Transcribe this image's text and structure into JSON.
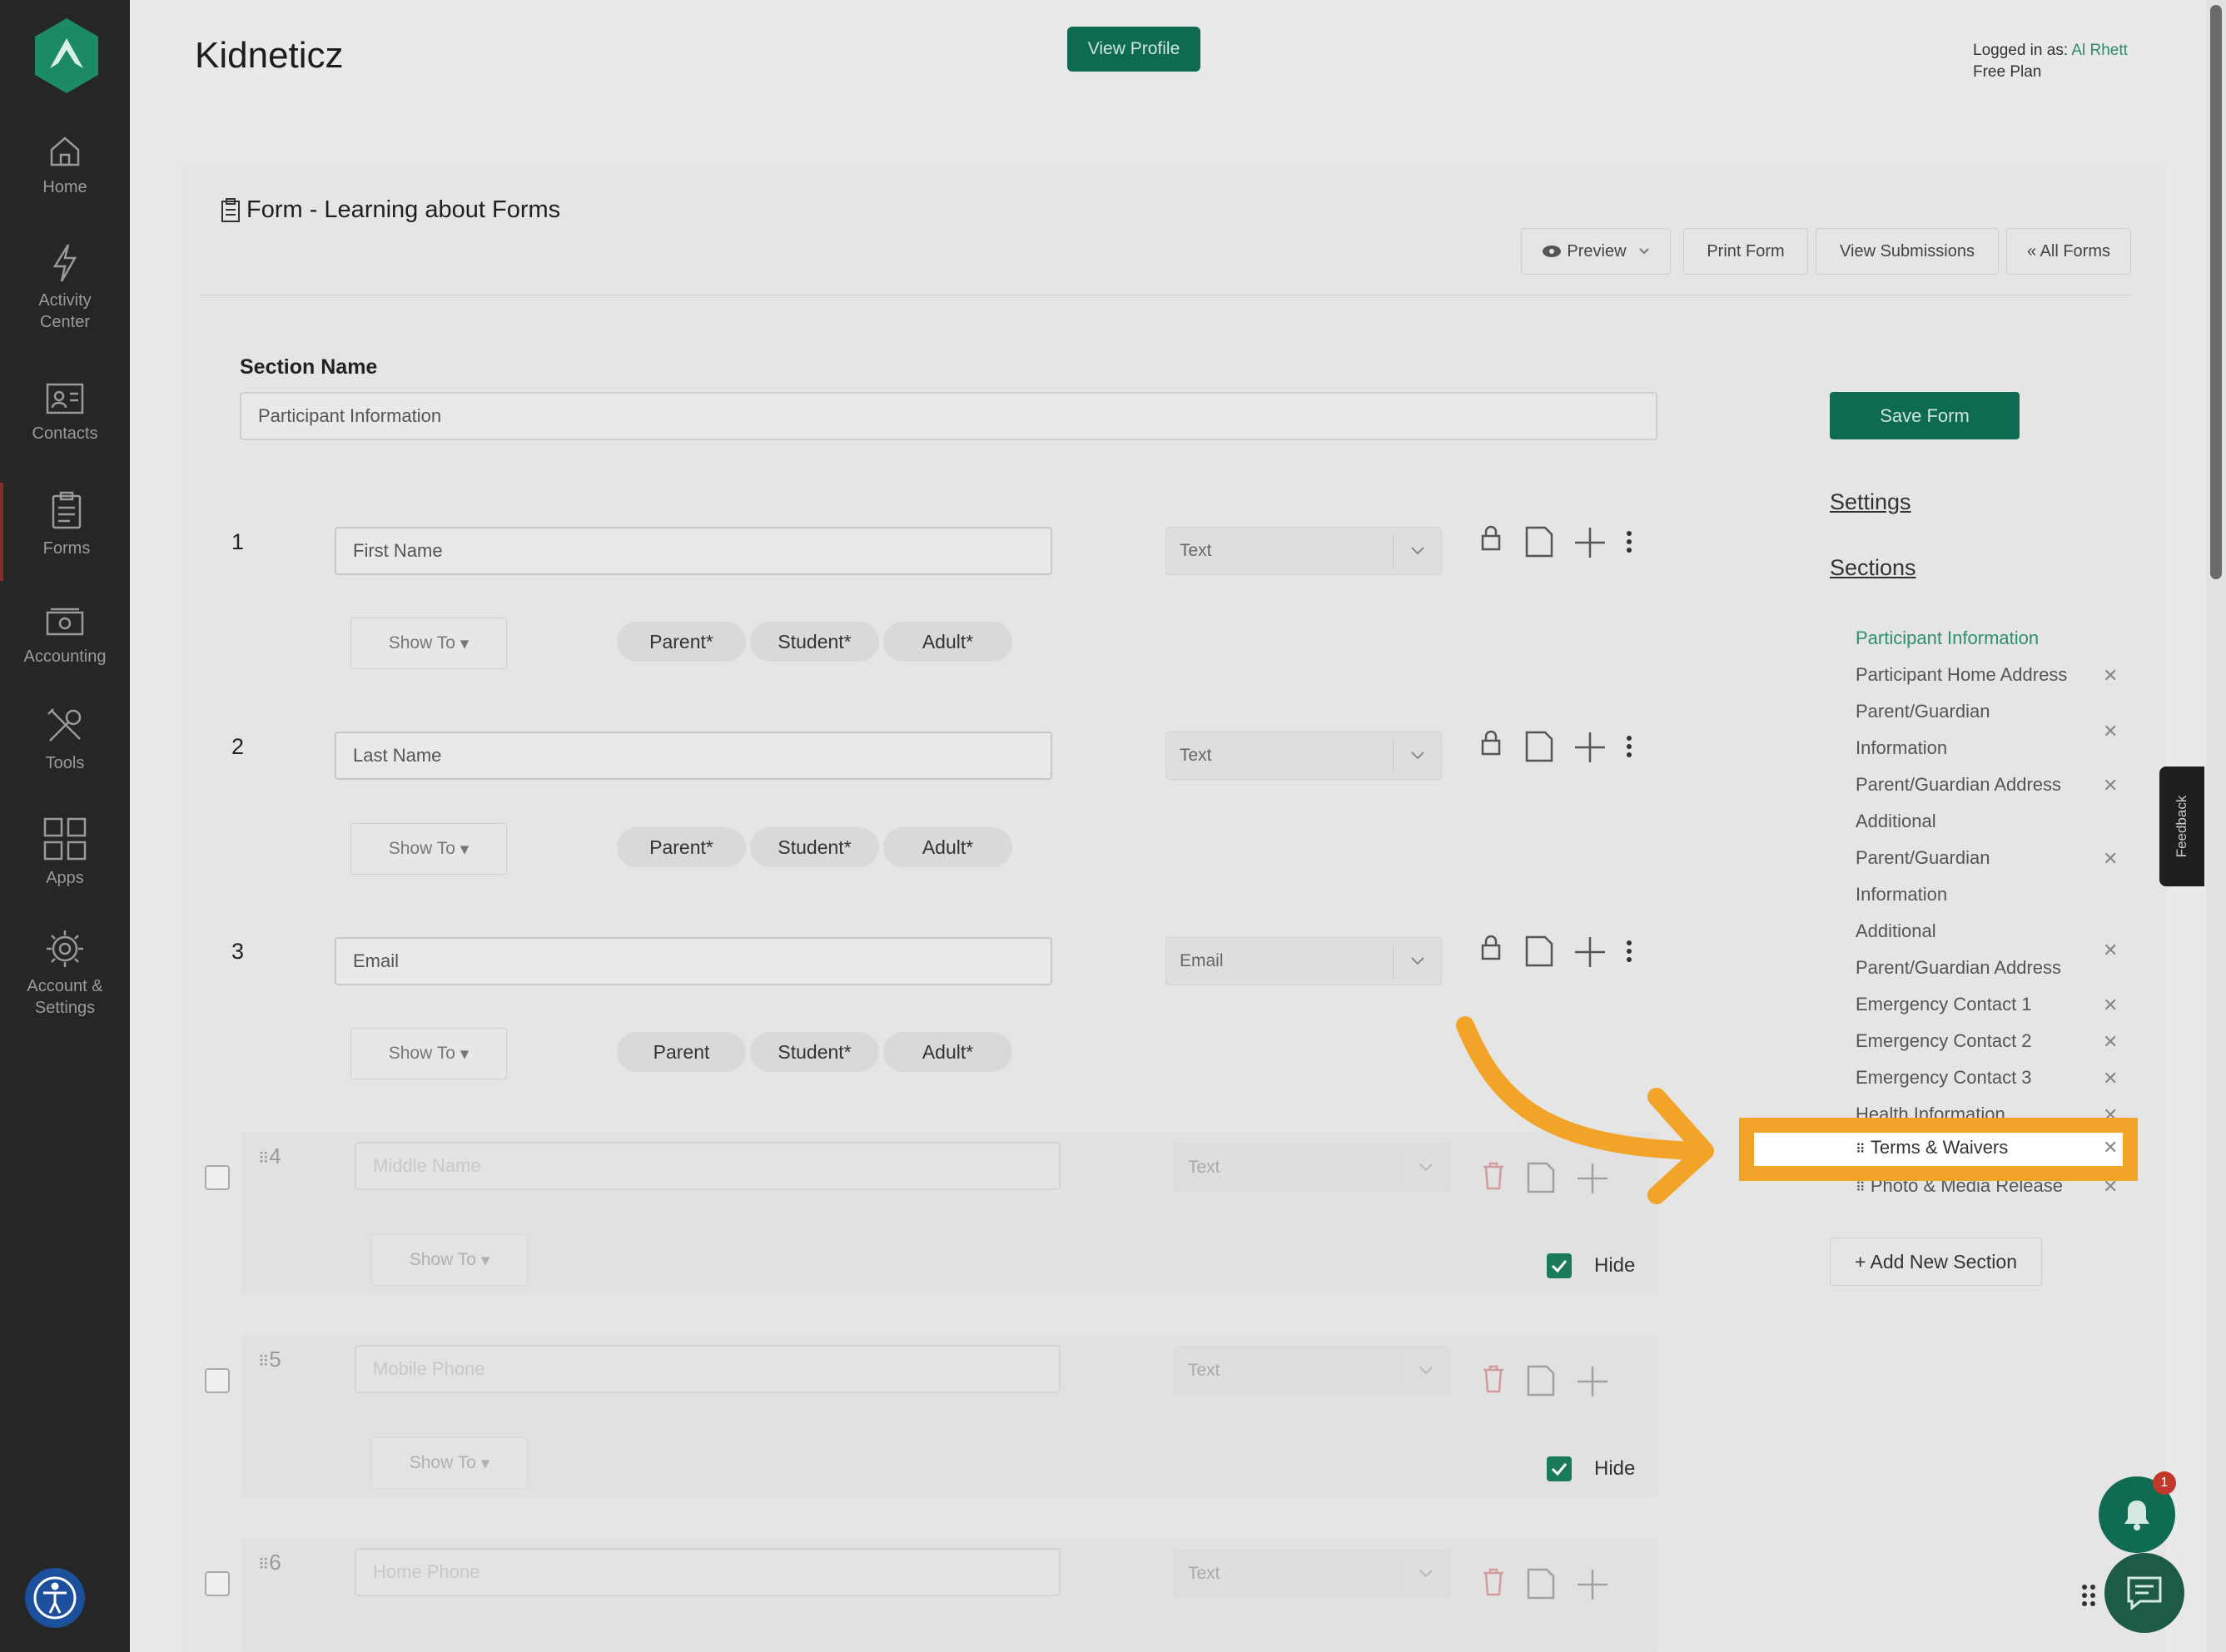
{
  "app": {
    "title": "Kidneticz",
    "view_profile": "View Profile"
  },
  "account": {
    "logged_in_prefix": "Logged in as:",
    "user": "Al Rhett",
    "plan": "Free Plan"
  },
  "sidebar": {
    "items": [
      {
        "label": "Home",
        "icon": "home-icon"
      },
      {
        "label": "Activity Center",
        "icon": "lightning-icon"
      },
      {
        "label": "Contacts",
        "icon": "contacts-icon"
      },
      {
        "label": "Forms",
        "icon": "clipboard-icon",
        "active": true
      },
      {
        "label": "Accounting",
        "icon": "money-icon"
      },
      {
        "label": "Tools",
        "icon": "tools-icon"
      },
      {
        "label": "Apps",
        "icon": "apps-grid-icon"
      },
      {
        "label": "Account & Settings",
        "icon": "gear-icon"
      }
    ]
  },
  "form": {
    "title": "Form - Learning about Forms",
    "toolbar": {
      "preview": "Preview",
      "print": "Print Form",
      "submissions": "View Submissions",
      "all_forms": "« All Forms"
    },
    "section_label": "Section Name",
    "section_value": "Participant Information",
    "save": "Save Form",
    "fields": [
      {
        "num": "1",
        "value": "First Name",
        "type": "Text",
        "show_to": "Show To",
        "pills": [
          "Parent*",
          "Student*",
          "Adult*"
        ]
      },
      {
        "num": "2",
        "value": "Last Name",
        "type": "Text",
        "show_to": "Show To",
        "pills": [
          "Parent*",
          "Student*",
          "Adult*"
        ]
      },
      {
        "num": "3",
        "value": "Email",
        "type": "Email",
        "show_to": "Show To",
        "pills": [
          "Parent",
          "Student*",
          "Adult*"
        ]
      }
    ],
    "hidden_fields": [
      {
        "num": "4",
        "placeholder": "Middle Name",
        "type": "Text",
        "show_to": "Show To",
        "hide": "Hide"
      },
      {
        "num": "5",
        "placeholder": "Mobile Phone",
        "type": "Text",
        "show_to": "Show To",
        "hide": "Hide"
      },
      {
        "num": "6",
        "placeholder": "Home Phone",
        "type": "Text"
      }
    ]
  },
  "right": {
    "settings": "Settings",
    "sections_title": "Sections",
    "sections": [
      "Participant Information",
      "Participant Home Address",
      "Parent/Guardian",
      "Information",
      "Parent/Guardian Address",
      "Additional",
      "Parent/Guardian",
      "Information",
      "Additional",
      "Parent/Guardian Address",
      "Emergency Contact 1",
      "Emergency Contact 2",
      "Emergency Contact 3",
      "Health Information",
      "Photo & Media Release"
    ],
    "dragging_section": "Terms & Waivers",
    "add_section": "+ Add New Section"
  },
  "widgets": {
    "feedback": "Feedback",
    "notifications_count": "1"
  },
  "colors": {
    "brand_green": "#0e6b51",
    "highlight_orange": "#f2a428",
    "active_section": "#2f8f6e"
  }
}
